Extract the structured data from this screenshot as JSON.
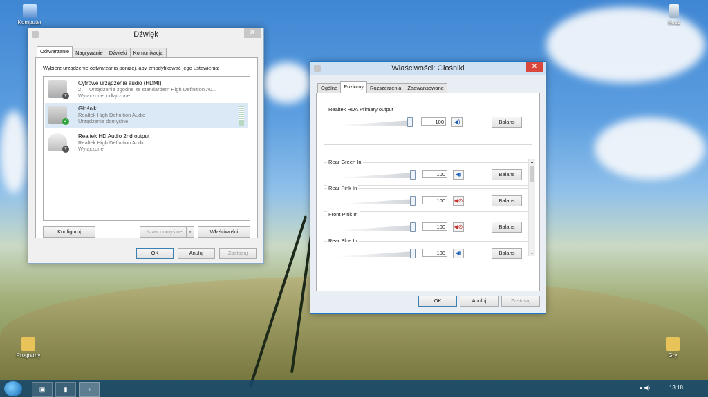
{
  "desktop": {
    "icons": [
      {
        "label": "Komputer"
      },
      {
        "label": "Kosz"
      },
      {
        "label": "Programy"
      },
      {
        "label": "Gry"
      }
    ]
  },
  "sound_dialog": {
    "title": "Dźwięk",
    "close": "✕",
    "tabs": [
      "Odtwarzanie",
      "Nagrywanie",
      "Dźwięki",
      "Komunikacja"
    ],
    "instruction": "Wybierz urządzenie odtwarzania poniżej, aby zmodyfikować jego ustawienia:",
    "devices": [
      {
        "name": "Cyfrowe urządzenie audio (HDMI)",
        "desc": "2 — Urządzenie zgodne ze standardem High Definition Au...",
        "status": "Wyłączone, odłączone"
      },
      {
        "name": "Głośniki",
        "desc": "Realtek High Definition Audio",
        "status": "Urządzenie domyślne"
      },
      {
        "name": "Realtek HD Audio 2nd output",
        "desc": "Realtek High Definition Audio",
        "status": "Wyłączone"
      }
    ],
    "buttons": {
      "configure": "Konfiguruj",
      "set_default": "Ustaw domyślne",
      "dropdown": "▾",
      "properties": "Właściwości",
      "ok": "OK",
      "cancel": "Anuluj",
      "apply": "Zastosuj"
    }
  },
  "props_dialog": {
    "title": "Właściwości: Głośniki",
    "close": "✕",
    "tabs": [
      "Ogólne",
      "Poziomy",
      "Rozszerzenia",
      "Zaawansowane"
    ],
    "primary": {
      "label": "Realtek HDA Primary output",
      "value": "100",
      "level": 1.0,
      "balance": "Balans"
    },
    "channels": [
      {
        "label": "Rear Green In",
        "value": "100",
        "level": 1.0,
        "muted": false,
        "balance": "Balans"
      },
      {
        "label": "Rear Pink In",
        "value": "100",
        "level": 1.0,
        "muted": true,
        "balance": "Balans"
      },
      {
        "label": "Front Pink In",
        "value": "100",
        "level": 1.0,
        "muted": true,
        "balance": "Balans"
      },
      {
        "label": "Rear Blue In",
        "value": "100",
        "level": 1.0,
        "muted": false,
        "balance": "Balans"
      }
    ],
    "speaker_glyph": "◀)",
    "muted_glyph": "◀⊘",
    "buttons": {
      "ok": "OK",
      "cancel": "Anuluj",
      "apply": "Zastosuj"
    }
  },
  "taskbar": {
    "buttons": [
      "▣",
      "▮",
      "♪"
    ],
    "tray": "▴  ◀)",
    "clock": "13:18"
  }
}
